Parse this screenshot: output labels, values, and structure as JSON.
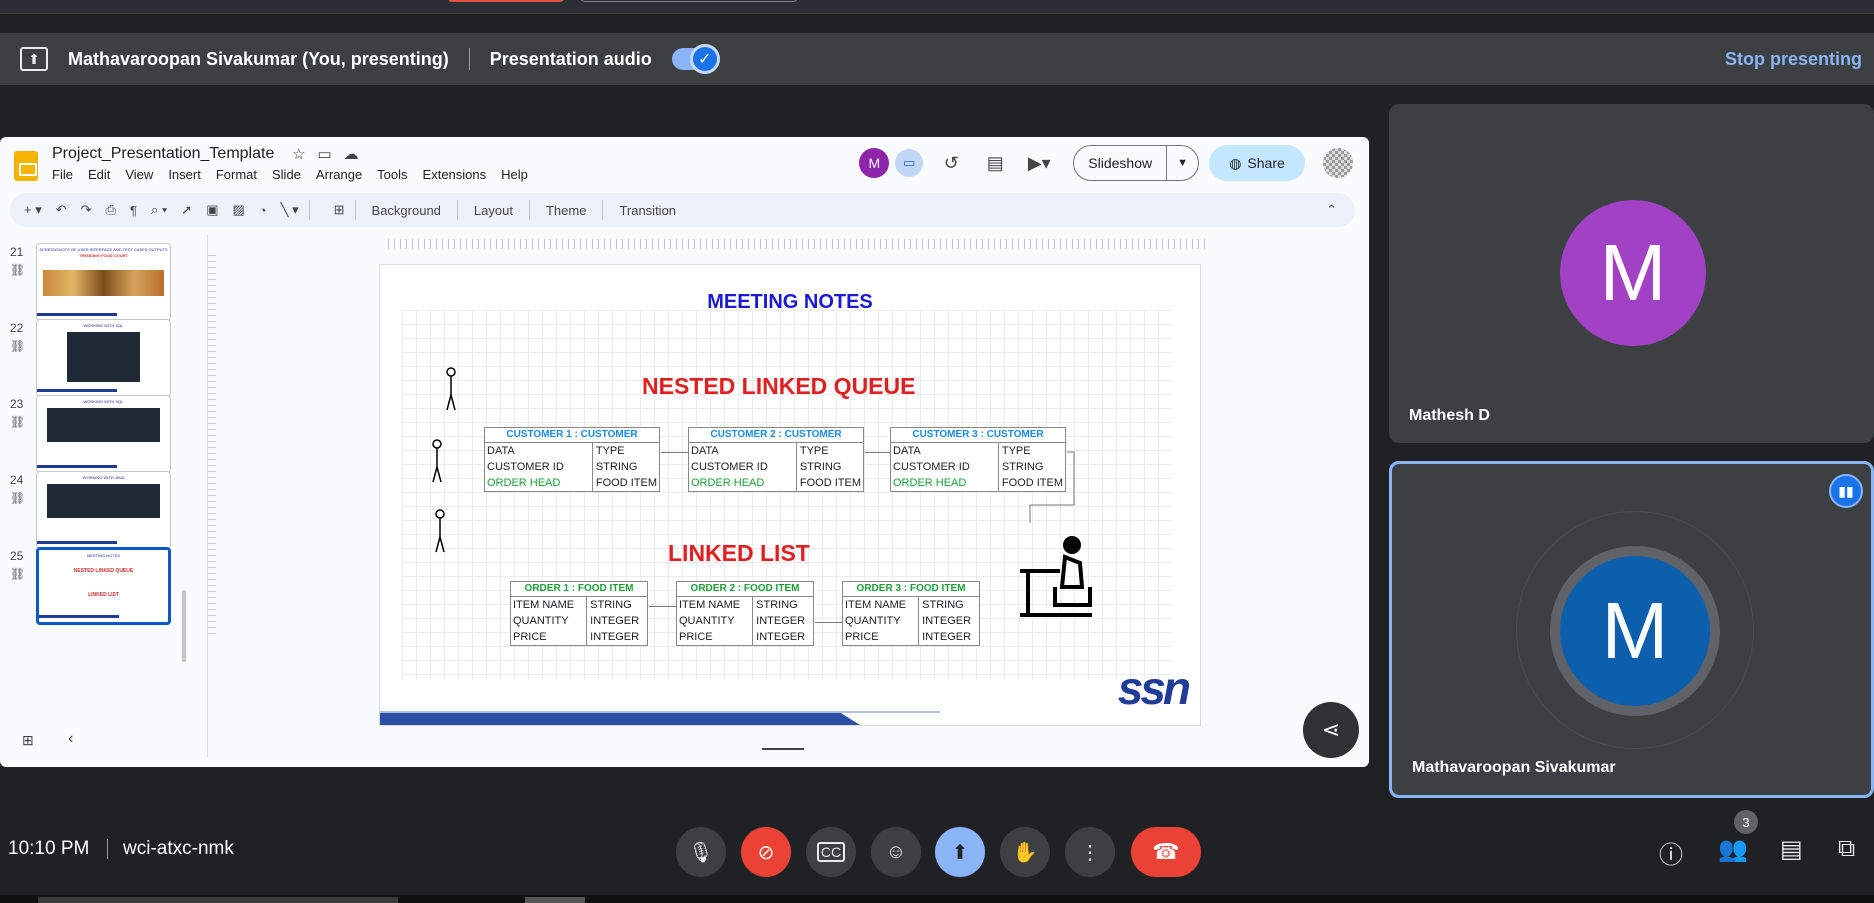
{
  "presenting_bar": {
    "presenter": "Mathavaroopan Sivakumar (You, presenting)",
    "audio_label": "Presentation audio",
    "audio_on": true,
    "stop_label": "Stop presenting"
  },
  "slides_app": {
    "doc_title": "Project_Presentation_Template",
    "menu": [
      "File",
      "Edit",
      "View",
      "Insert",
      "Format",
      "Slide",
      "Arrange",
      "Tools",
      "Extensions",
      "Help"
    ],
    "avatar_letter": "M",
    "slideshow_label": "Slideshow",
    "share_label": "Share",
    "toolbar": {
      "background": "Background",
      "layout": "Layout",
      "theme": "Theme",
      "transition": "Transition"
    },
    "thumbnails": [
      {
        "num": "21",
        "caption": "SCREENSHOTS OF USER INTERFACE AND TEST CASES OUTPUTS",
        "sub": "TRENDING FOOD COURT"
      },
      {
        "num": "22",
        "caption": "WORKING WITH SQL"
      },
      {
        "num": "23",
        "caption": "WORKING WITH SQL"
      },
      {
        "num": "24",
        "caption": "WORKING WITH JAVA"
      },
      {
        "num": "25",
        "caption": "MEETING NOTES",
        "sub": "NESTED LINKED QUEUE",
        "sub2": "LINKED LIST"
      }
    ]
  },
  "slide": {
    "title": "MEETING NOTES",
    "heading1": "NESTED LINKED QUEUE",
    "heading2": "LINKED LIST",
    "customers": [
      {
        "header": "CUSTOMER 1 : CUSTOMER",
        "rows": [
          [
            "DATA",
            "TYPE"
          ],
          [
            "CUSTOMER ID",
            "STRING"
          ],
          [
            "ORDER HEAD",
            "FOOD ITEM"
          ]
        ]
      },
      {
        "header": "CUSTOMER 2 : CUSTOMER",
        "rows": [
          [
            "DATA",
            "TYPE"
          ],
          [
            "CUSTOMER ID",
            "STRING"
          ],
          [
            "ORDER HEAD",
            "FOOD ITEM"
          ]
        ]
      },
      {
        "header": "CUSTOMER 3 : CUSTOMER",
        "rows": [
          [
            "DATA",
            "TYPE"
          ],
          [
            "CUSTOMER ID",
            "STRING"
          ],
          [
            "ORDER HEAD",
            "FOOD ITEM"
          ]
        ]
      }
    ],
    "orders": [
      {
        "header": "ORDER 1 : FOOD ITEM",
        "rows": [
          [
            "ITEM NAME",
            "STRING"
          ],
          [
            "QUANTITY",
            "INTEGER"
          ],
          [
            "PRICE",
            "INTEGER"
          ]
        ]
      },
      {
        "header": "ORDER 2 : FOOD ITEM",
        "rows": [
          [
            "ITEM NAME",
            "STRING"
          ],
          [
            "QUANTITY",
            "INTEGER"
          ],
          [
            "PRICE",
            "INTEGER"
          ]
        ]
      },
      {
        "header": "ORDER 3 : FOOD ITEM",
        "rows": [
          [
            "ITEM NAME",
            "STRING"
          ],
          [
            "QUANTITY",
            "INTEGER"
          ],
          [
            "PRICE",
            "INTEGER"
          ]
        ]
      }
    ],
    "logo_text": "ssn"
  },
  "participants": [
    {
      "name": "Mathesh D",
      "initial": "M",
      "color": "#a142c4"
    },
    {
      "name": "Mathavaroopan Sivakumar",
      "initial": "M",
      "color": "#0b5fad",
      "speaking": true
    }
  ],
  "bottom_bar": {
    "time": "10:10 PM",
    "meeting_code": "wci-atxc-nmk",
    "people_count": "3"
  },
  "colors": {
    "accent": "#8ab4f8",
    "danger": "#ea4335",
    "bg": "#202124"
  }
}
